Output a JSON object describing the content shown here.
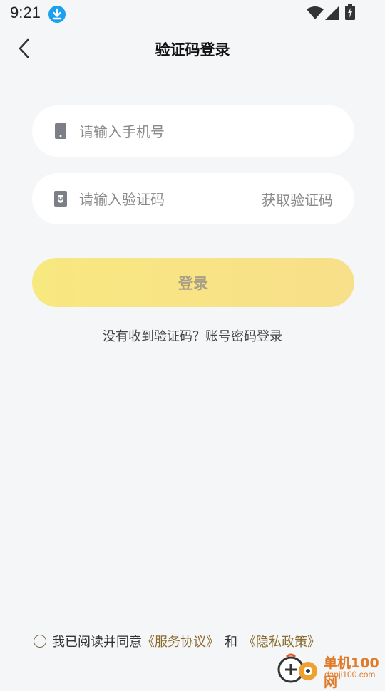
{
  "status_bar": {
    "time": "9:21",
    "icons": [
      "download-icon",
      "wifi-icon",
      "signal-icon",
      "battery-charging-icon"
    ]
  },
  "nav": {
    "back_icon": "chevron-left-icon",
    "title": "验证码登录"
  },
  "phone_field": {
    "icon": "phone-icon",
    "placeholder": "请输入手机号",
    "value": ""
  },
  "code_field": {
    "icon": "shield-code-icon",
    "placeholder": "请输入验证码",
    "value": "",
    "get_code_label": "获取验证码"
  },
  "login_button": {
    "label": "登录",
    "gradient_start": "#f8e880",
    "gradient_end": "#f8df8a",
    "text_color": "#a99e86"
  },
  "alt_login_link": "没有收到验证码？账号密码登录",
  "agreement": {
    "checked": false,
    "prefix": "我已阅读并同意",
    "service_link": "《服务协议》",
    "and": "和",
    "privacy_link": "《隐私政策》",
    "link_color": "#8a6d2e"
  },
  "watermark": {
    "cn": "单机100网",
    "url": "danji100.com"
  },
  "colors": {
    "background": "#f5f6f8",
    "field_background": "#ffffff",
    "accent_blue": "#1aa0f0"
  }
}
